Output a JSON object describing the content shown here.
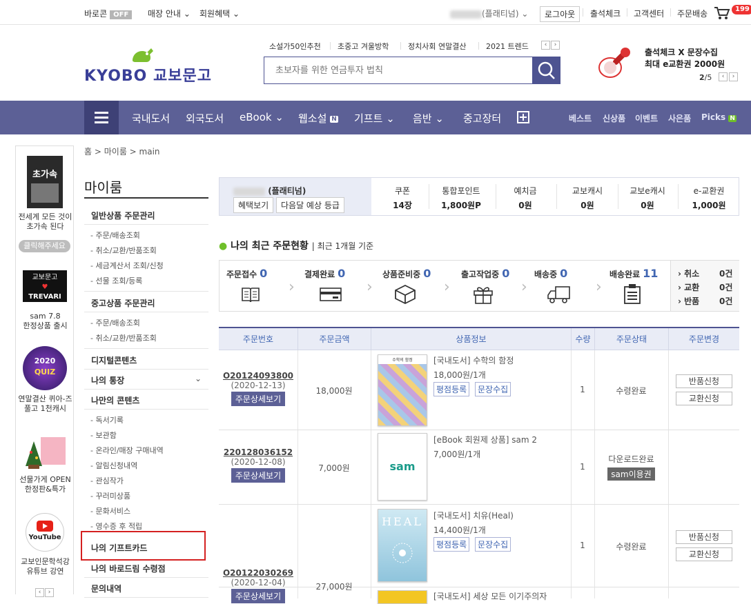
{
  "topbar": {
    "barocon": "바로콘",
    "barocon_state": "OFF",
    "store_info": "매장 안내",
    "member_benefit": "회원혜택",
    "user_grade": "(플래티넘)",
    "logout": "로그아웃",
    "attendance": "출석체크",
    "customer_center": "고객센터",
    "order_delivery": "주문배송",
    "cart_count": "199"
  },
  "header": {
    "logo_en": "KYOBO",
    "logo_kr": "교보문고",
    "keywords": [
      "소설가50인추천",
      "초중고 겨울방학",
      "정치사회 연말결산",
      "2021 트렌드"
    ],
    "search_placeholder": "초보자를 위한 연금투자 법칙",
    "promo_line1": "출석체크 X 문장수집",
    "promo_line2": "최대 e교환권 2000원",
    "promo_page": "2",
    "promo_total": "/5"
  },
  "nav": {
    "items": [
      "국내도서",
      "외국도서",
      "eBook",
      "웹소설",
      "기프트",
      "음반",
      "중고장터"
    ],
    "new_badge": "N",
    "right_items": [
      "베스트",
      "신상품",
      "이벤트",
      "사은품",
      "Picks"
    ]
  },
  "banners": [
    {
      "cover": "초가속",
      "label1": "전세계 모든 것이",
      "label2": "초가속 된다"
    },
    {
      "button": "클릭해주세요"
    },
    {
      "cover1": "교보문고",
      "cover2": "TREVARI",
      "label1": "sam 7.8",
      "label2": "한정상품 출시"
    },
    {
      "cover1": "2020",
      "cover2": "QUIZ",
      "label1": "연말결산 퀴아-즈",
      "label2": "풀고 1천캐시"
    },
    {
      "label1": "선물가게 OPEN",
      "label2": "한정판&특가"
    },
    {
      "cover": "YouTube",
      "label1": "교보인문학석강",
      "label2": "유튜브 강연"
    }
  ],
  "breadcrumb": {
    "home": "홈",
    "myroom": "마이룸",
    "current": "main"
  },
  "sidebar": {
    "title": "마이룸",
    "general_orders": "일반상품 주문관리",
    "general_sub": [
      "주문/배송조회",
      "취소/교환/반품조회",
      "세금계산서 조회/신청",
      "선물 조회/등록"
    ],
    "used_orders": "중고상품 주문관리",
    "used_sub": [
      "주문/배송조회",
      "취소/교환/반품조회"
    ],
    "digital": "디지털콘텐츠",
    "bankbook": "나의 통장",
    "my_contents": "나만의 콘텐츠",
    "contents_sub": [
      "독서기록",
      "보관함",
      "온라인/매장 구매내역",
      "알림신청내역",
      "관심작가",
      "꾸러미상품",
      "문화서비스",
      "영수증 후 적립"
    ],
    "gift_card": "나의 기프트카드",
    "barodrim": "나의 바로드림 수령점",
    "inquiry": "문의내역"
  },
  "summary": {
    "grade": "(플래티넘)",
    "benefit_btn": "혜택보기",
    "next_grade_btn": "다음달 예상 등급",
    "stats": [
      {
        "label": "쿠폰",
        "value": "14장"
      },
      {
        "label": "통합포인트",
        "value": "1,800원P"
      },
      {
        "label": "예치금",
        "value": "0원"
      },
      {
        "label": "교보캐시",
        "value": "0원"
      },
      {
        "label": "교보e캐시",
        "value": "0원"
      },
      {
        "label": "e-교환권",
        "value": "1,000원"
      }
    ]
  },
  "order_status": {
    "title": "나의 최근 주문현황",
    "period": "최근 1개월 기준",
    "steps": [
      {
        "label": "주문접수",
        "count": "0"
      },
      {
        "label": "결제완료",
        "count": "0"
      },
      {
        "label": "상품준비중",
        "count": "0"
      },
      {
        "label": "출고작업중",
        "count": "0"
      },
      {
        "label": "배송중",
        "count": "0"
      },
      {
        "label": "배송완료",
        "count": "11"
      }
    ],
    "claims": [
      {
        "label": "취소",
        "count": "0건"
      },
      {
        "label": "교환",
        "count": "0건"
      },
      {
        "label": "반품",
        "count": "0건"
      }
    ]
  },
  "table": {
    "headers": [
      "주문번호",
      "주문금액",
      "상품정보",
      "수량",
      "주문상태",
      "주문변경"
    ],
    "detail_btn": "주문상세보기",
    "rows": [
      {
        "order_no": "O20124093800",
        "date": "(2020-12-13)",
        "amount": "18,000원",
        "product": "[국내도서] 수학의 함정",
        "price": "18,000원/1개",
        "qty": "1",
        "status": "수령완료",
        "tags": [
          "평점등록",
          "문장수집"
        ],
        "actions": [
          "반품신청",
          "교환신청"
        ],
        "cover": "수학의 함정"
      },
      {
        "order_no": "220128036152",
        "date": "(2020-12-08)",
        "amount": "7,000원",
        "product": "[eBook 회원제 상품] sam 2",
        "price": "7,000원/1개",
        "qty": "1",
        "status": "다운로드완료",
        "status_btn": "sam이용권",
        "cover": "sam"
      },
      {
        "order_no": "O20122030269",
        "date": "(2020-12-04)",
        "amount": "27,000원",
        "product": "[국내도서] 치유(Heal)",
        "price": "14,400원/1개",
        "qty": "1",
        "status": "수령완료",
        "tags": [
          "평점등록",
          "문장수집"
        ],
        "actions": [
          "반품신청",
          "교환신청"
        ],
        "cover": "HEAL"
      },
      {
        "product": "[국내도서] 세상 모든 이기주의자"
      }
    ]
  }
}
